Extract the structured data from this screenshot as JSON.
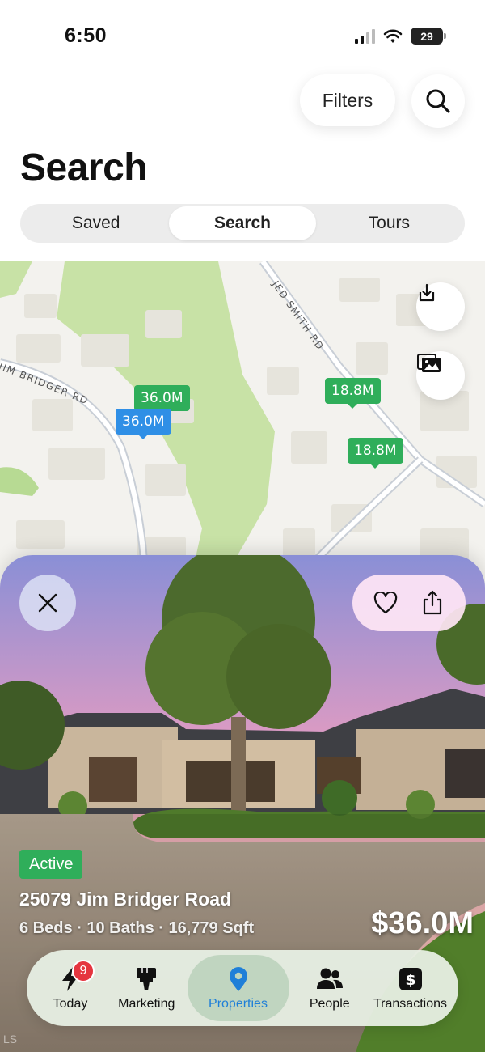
{
  "status_bar": {
    "time": "6:50",
    "battery": "29"
  },
  "header": {
    "filters_label": "Filters",
    "search_icon": "search-icon",
    "title": "Search"
  },
  "segments": [
    {
      "label": "Saved",
      "active": false
    },
    {
      "label": "Search",
      "active": true
    },
    {
      "label": "Tours",
      "active": false
    }
  ],
  "map": {
    "road_labels": [
      "JED SMITH RD",
      "JIM BRIDGER RD"
    ],
    "pins": [
      {
        "label": "36.0M",
        "color": "#2fae5a"
      },
      {
        "label": "36.0M",
        "color": "#2f8fe6"
      },
      {
        "label": "18.8M",
        "color": "#2fae5a"
      },
      {
        "label": "18.8M",
        "color": "#2fae5a"
      }
    ],
    "buttons": [
      "download-icon",
      "photos-icon"
    ]
  },
  "listing": {
    "status": "Active",
    "address": "25079 Jim Bridger Road",
    "specs": "6 Beds · 10 Baths · 16,779 Sqft",
    "price": "$36.0M",
    "actions": [
      "close-icon",
      "heart-icon",
      "share-icon"
    ]
  },
  "tab_bar": {
    "items": [
      {
        "label": "Today",
        "icon": "bolt-icon",
        "badge": "9",
        "active": false
      },
      {
        "label": "Marketing",
        "icon": "paint-brush-icon",
        "active": false
      },
      {
        "label": "Properties",
        "icon": "map-pin-icon",
        "active": true
      },
      {
        "label": "People",
        "icon": "people-icon",
        "active": false
      },
      {
        "label": "Transactions",
        "icon": "dollar-icon",
        "active": false
      }
    ]
  },
  "watermark": "LS",
  "colors": {
    "accent_green": "#2fae5a",
    "accent_blue": "#1f7fd8",
    "badge_red": "#e5353f"
  }
}
